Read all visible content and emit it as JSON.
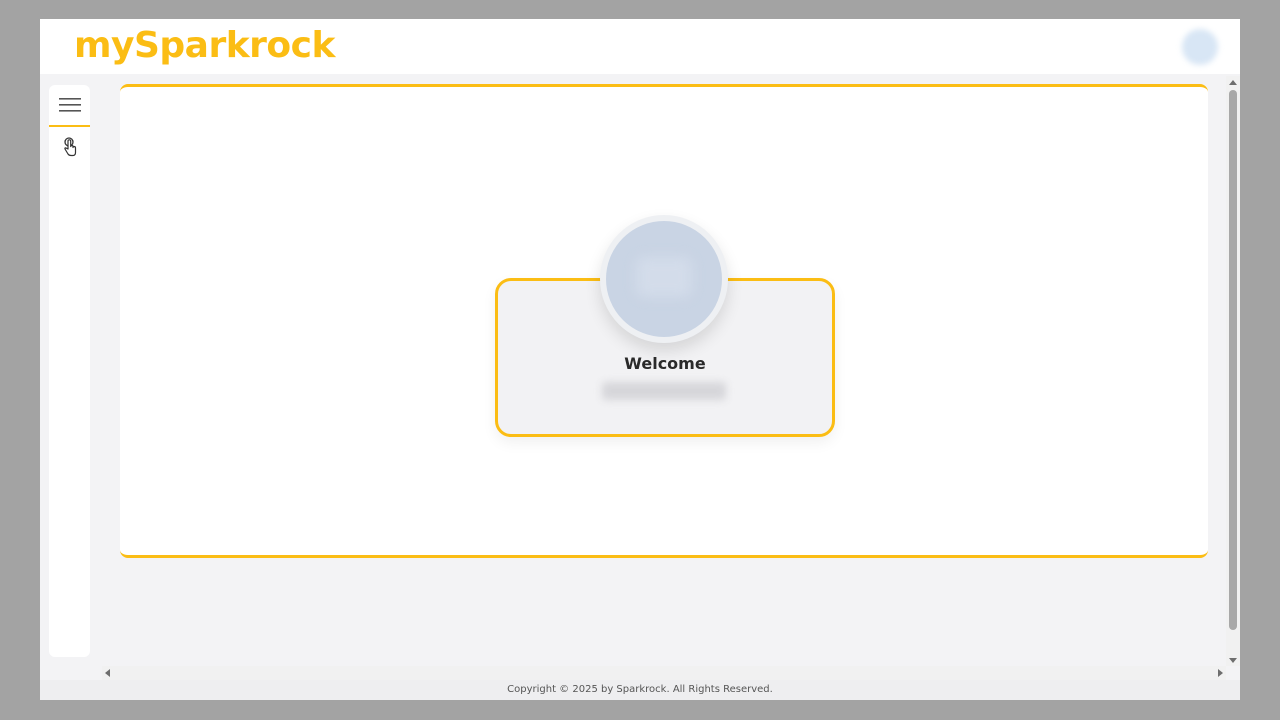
{
  "header": {
    "logo_text": "mySparkrock"
  },
  "rail": {
    "menu_icon": "hamburger-icon",
    "touch_icon": "touch-pointer-icon"
  },
  "main": {
    "welcome_title": "Welcome"
  },
  "footer": {
    "copyright": "Copyright © 2025 by Sparkrock. All Rights Reserved."
  },
  "colors": {
    "accent": "#fbbd14",
    "background": "#f3f3f5",
    "card": "#ffffff",
    "avatar": "#c9d4e4"
  }
}
